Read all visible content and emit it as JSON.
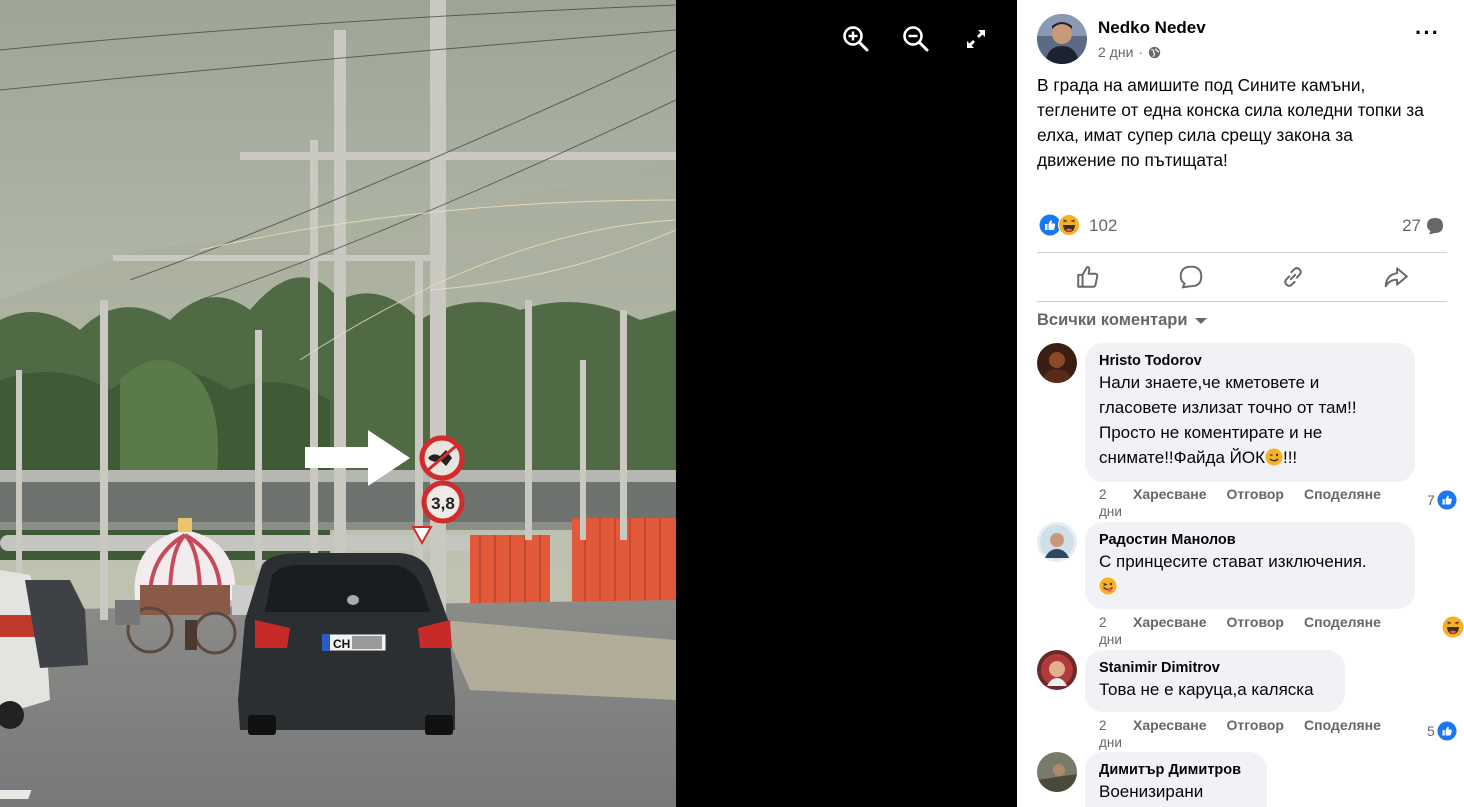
{
  "viewer": {
    "tools": [
      "zoom-in-icon",
      "zoom-out-icon",
      "fullscreen-icon"
    ],
    "sign_plate": "3,8"
  },
  "post": {
    "author": "Nedko Nedev",
    "time": "2 дни",
    "visibility_icon": "globe-icon",
    "more_icon": "more-icon",
    "text": "В града на амишите под Сините камъни, теглените от една конска сила коледни топки за елха, имат супер сила срещу закона за движение по пътищата!",
    "reaction_count": "102",
    "comment_count": "27",
    "actions": [
      "like-icon",
      "comment-icon",
      "share-link-icon",
      "share-icon"
    ]
  },
  "comments_filter": "Всички коментари",
  "comments": [
    {
      "name": "Hristo Todorov",
      "lines": [
        "Нали знаете,че кметовете и",
        "гласовете излизат точно от там!!",
        "Просто не коментирате и не",
        "снимате!!Файда ЙОК"
      ],
      "tail": "!!!",
      "time_num": "2",
      "time_unit": "дни",
      "like": "Харесване",
      "reply": "Отговор",
      "share": "Споделяне",
      "reaction_count": "7"
    },
    {
      "name": "Радостин Манолов",
      "lines": [
        "С принцесите стават изключения."
      ],
      "time_num": "2",
      "time_unit": "дни",
      "like": "Харесване",
      "reply": "Отговор",
      "share": "Споделяне"
    },
    {
      "name": "Stanimir Dimitrov",
      "lines": [
        "Това не е каруца,а каляска"
      ],
      "time_num": "2",
      "time_unit": "дни",
      "like": "Харесване",
      "reply": "Отговор",
      "share": "Споделяне",
      "reaction_count": "5"
    },
    {
      "name": "Димитър Димитров",
      "lines": [
        "Военизирани"
      ]
    }
  ],
  "colors": {
    "fb_blue": "#1877f2",
    "text_secondary": "#65676b",
    "bubble": "#f0f2f5"
  }
}
